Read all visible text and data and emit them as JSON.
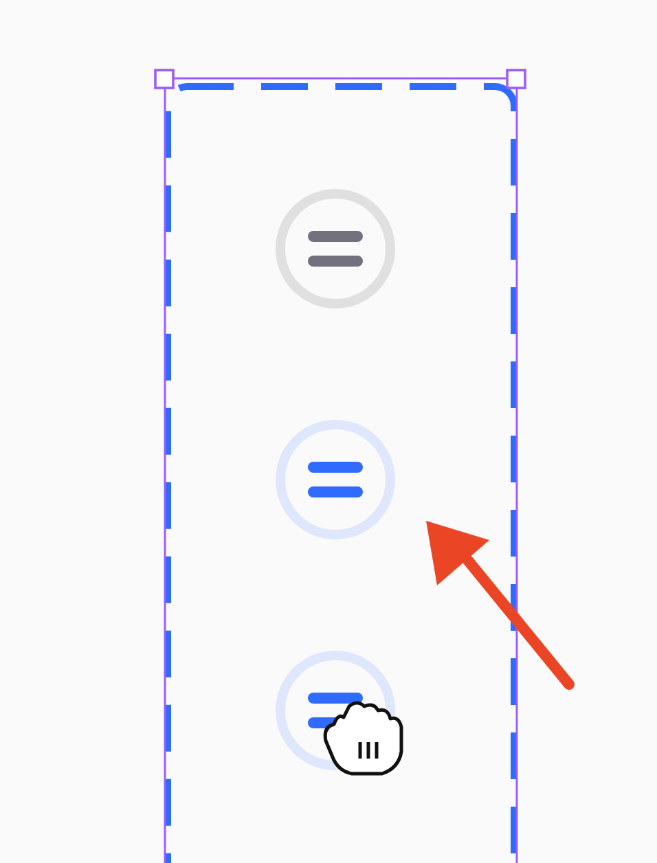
{
  "handles": [
    {
      "active": false
    },
    {
      "active": true
    },
    {
      "active": true,
      "grabbed": true
    }
  ]
}
